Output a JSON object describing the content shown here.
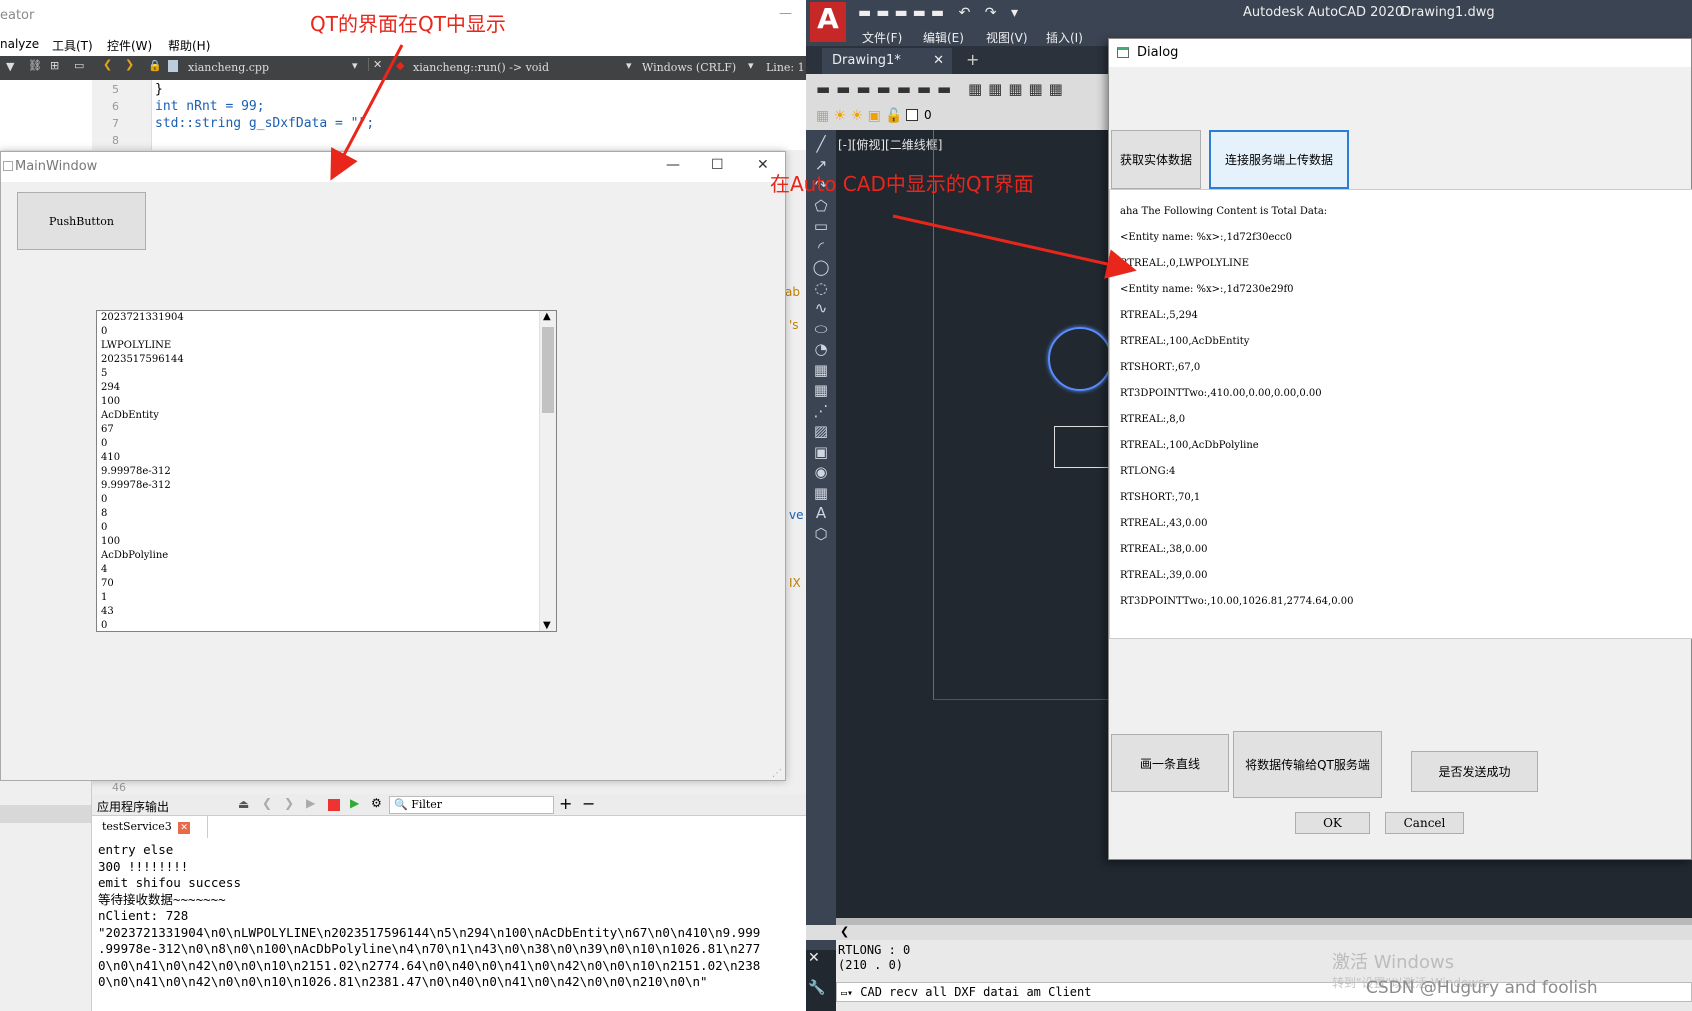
{
  "qt_creator": {
    "title_fragment": "eator",
    "menu": [
      "nalyze",
      "工具(T)",
      "控件(W)",
      "帮助(H)"
    ],
    "toolbar": {
      "file_name": "xiancheng.cpp",
      "function": "xiancheng::run() -> void",
      "line_ending": "Windows (CRLF)",
      "line_label": "Line: 1"
    },
    "code_lines": [
      {
        "num": "5",
        "text": "}"
      },
      {
        "num": "6",
        "text": "int nRnt = 99;"
      },
      {
        "num": "7",
        "text": "std::string g_sDxfData = \"\";"
      },
      {
        "num": "8",
        "text": ""
      }
    ],
    "line_46": "46",
    "side_fragments": [
      "ab",
      "'s",
      "ve",
      "IX"
    ]
  },
  "main_window": {
    "title": "MainWindow",
    "push_button": "PushButton",
    "list_items": [
      "2023721331904",
      "0",
      "LWPOLYLINE",
      "2023517596144",
      "5",
      "294",
      "100",
      "AcDbEntity",
      "67",
      "0",
      "410",
      "9.99978e-312",
      "9.99978e-312",
      "0",
      "8",
      "0",
      "100",
      "AcDbPolyline",
      "4",
      "70",
      "1",
      "43",
      "0"
    ]
  },
  "output_pane": {
    "title": "应用程序输出",
    "filter_placeholder": "Filter",
    "tab_label": "testService3",
    "lines": [
      "entry else",
      "300 !!!!!!!!",
      "emit shifou success",
      "等待接收数据~~~~~~~",
      "nClient: 728",
      "\"2023721331904\\n0\\nLWPOLYLINE\\n2023517596144\\n5\\n294\\n100\\nAcDbEntity\\n67\\n0\\n410\\n9.999",
      ".99978e-312\\n0\\n8\\n0\\n100\\nAcDbPolyline\\n4\\n70\\n1\\n43\\n0\\n38\\n0\\n39\\n0\\n10\\n1026.81\\n277",
      "0\\n0\\n41\\n0\\n42\\n0\\n0\\n10\\n2151.02\\n2774.64\\n0\\n40\\n0\\n41\\n0\\n42\\n0\\n0\\n10\\n2151.02\\n238",
      "0\\n0\\n41\\n0\\n42\\n0\\n0\\n10\\n1026.81\\n2381.47\\n0\\n40\\n0\\n41\\n0\\n42\\n0\\n0\\n210\\n0\\n\""
    ]
  },
  "autocad": {
    "app_title": "Autodesk AutoCAD 2020",
    "doc_title": "Drawing1.dwg",
    "menu": [
      "文件(F)",
      "编辑(E)",
      "视图(V)",
      "插入(I)"
    ],
    "tab": "Drawing1*",
    "layer_value": "0",
    "viewport_label": "[-][俯视][二维线框]",
    "cmd_lines": [
      "RTLONG : 0",
      "(210 . 0)"
    ],
    "cmd_input": "CAD recv all DXF datai am Client",
    "watermark_1": "激活 Windows",
    "watermark_2": "转到\"设置\"以激活 Windows。",
    "csdn": "CSDN @Hugury and foolish"
  },
  "dialog": {
    "title": "Dialog",
    "btn_get": "获取实体数据",
    "btn_connect": "连接服务端上传数据",
    "btn_line": "画一条直线",
    "btn_send": "将数据传输给QT服务端",
    "btn_success": "是否发送成功",
    "btn_ok": "OK",
    "btn_cancel": "Cancel",
    "text_lines": [
      "aha The Following Content is Total Data:",
      "<Entity name: %x>:,1d72f30ecc0",
      "RTREAL:,0,LWPOLYLINE",
      "<Entity name: %x>:,1d7230e29f0",
      "RTREAL:,5,294",
      "RTREAL:,100,AcDbEntity",
      "RTSHORT:,67,0",
      "RT3DPOINTTwo:,410.00,0.00,0.00,0.00",
      "RTREAL:,8,0",
      "RTREAL:,100,AcDbPolyline",
      "RTLONG:4",
      "RTSHORT:,70,1",
      "RTREAL:,43,0.00",
      "RTREAL:,38,0.00",
      "RTREAL:,39,0.00",
      "RT3DPOINTTwo:,10.00,1026.81,2774.64,0.00"
    ]
  },
  "annotations": {
    "qt_label": "QT的界面在QT中显示",
    "cad_label": "在Auto CAD中显示的QT界面"
  },
  "colors": {
    "accent_red": "#e8261b",
    "cad_bg": "#212830"
  }
}
